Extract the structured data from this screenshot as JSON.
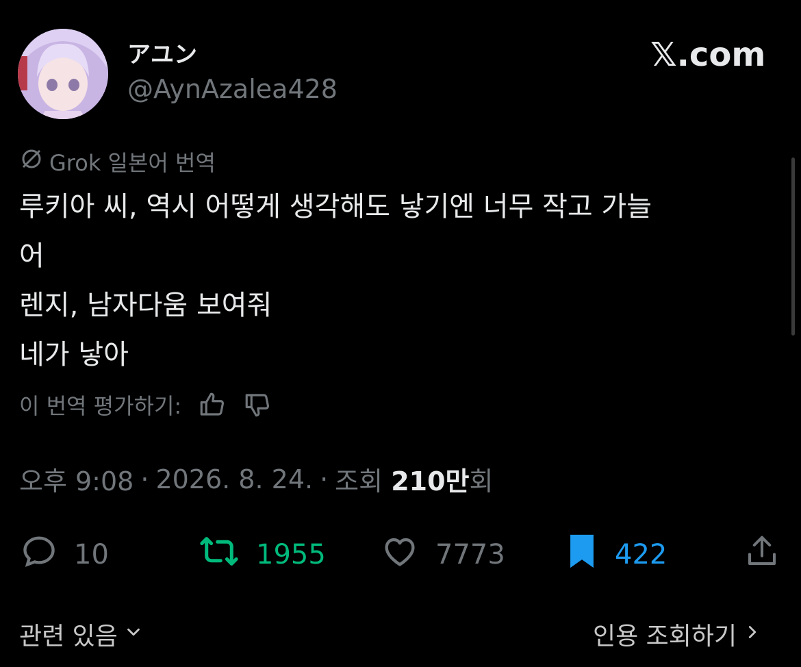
{
  "author": {
    "display_name": "アユン",
    "handle": "@AynAzalea428"
  },
  "brand": {
    "logo_text": "𝕏.com"
  },
  "translation": {
    "label": "Grok 일본어 번역"
  },
  "tweet": {
    "lines": [
      "루키아 씨, 역시 어떻게 생각해도 낳기엔 너무 작고 가늘",
      "어",
      "렌지, 남자다움 보여줘",
      "네가 낳아"
    ]
  },
  "rating": {
    "label": "이 번역 평가하기:"
  },
  "meta": {
    "time": "오후 9:08",
    "sep1": "·",
    "date": "2026. 8. 24.",
    "sep2": "·",
    "views_prefix": "조회",
    "views_count": "210만",
    "views_suffix": "회"
  },
  "actions": {
    "replies": "10",
    "retweets": "1955",
    "likes": "7773",
    "bookmarks": "422"
  },
  "footer": {
    "related": "관련 있음",
    "quotes": "인용 조회하기"
  },
  "colors": {
    "background": "#000000",
    "text": "#e7e9ea",
    "muted": "#71767b",
    "retweet": "#00ba7c",
    "bookmark": "#1d9bf0"
  }
}
